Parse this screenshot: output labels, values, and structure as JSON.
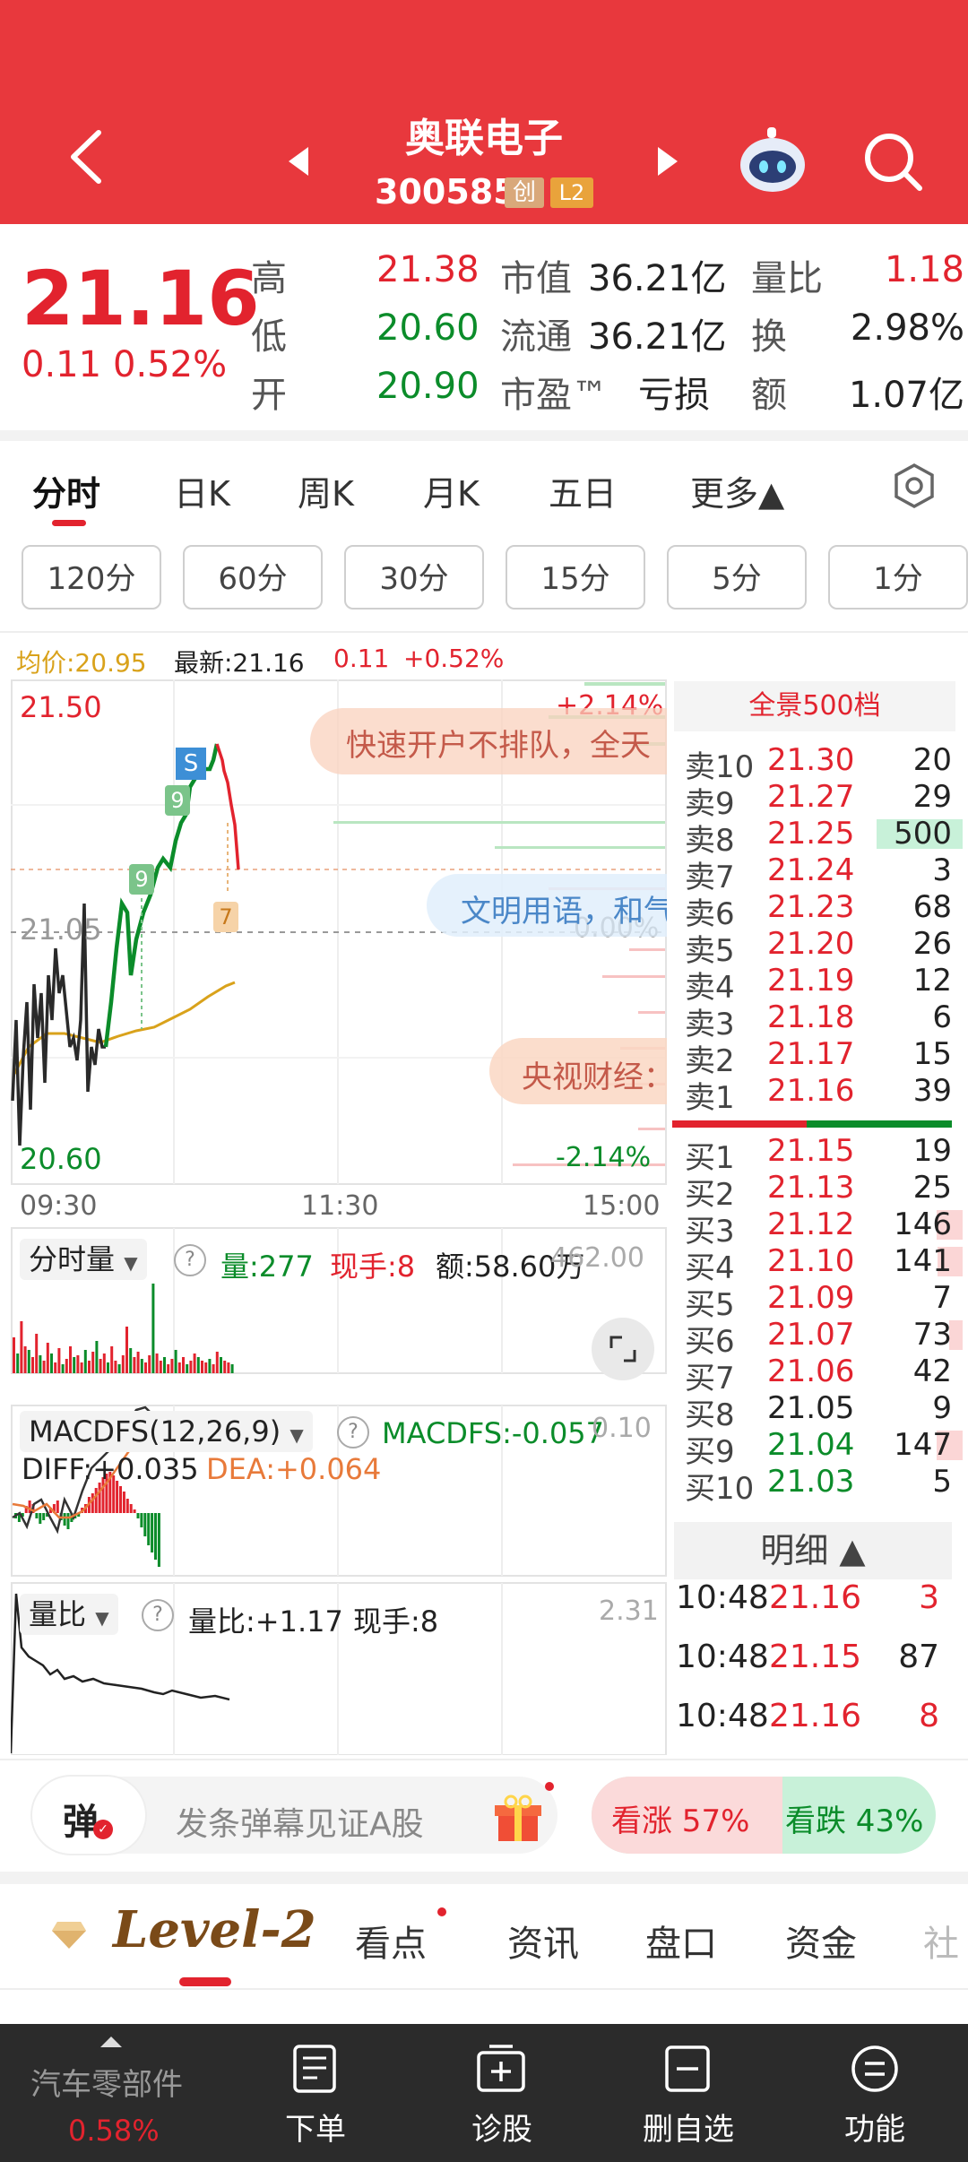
{
  "header": {
    "stock_name": "奥联电子",
    "stock_code": "300585",
    "badge_chuang": "创",
    "badge_l2": "L2",
    "back_icon": "back-arrow-icon",
    "prev_icon": "caret-left-icon",
    "next_icon": "caret-right-icon",
    "robot_icon": "robot-icon",
    "search_icon": "search-icon"
  },
  "quote": {
    "price": "21.16",
    "change": "0.11",
    "change_pct": "0.52%",
    "high_label": "高",
    "high": "21.38",
    "low_label": "低",
    "low": "20.60",
    "open_label": "开",
    "open": "20.90",
    "mcap_label": "市值",
    "mcap": "36.21亿",
    "float_label": "流通",
    "float": "36.21亿",
    "pe_label": "市盈™",
    "pe": "亏损",
    "vr_label": "量比",
    "vr": "1.18",
    "turn_label": "换",
    "turn": "2.98%",
    "amount_label": "额",
    "amount": "1.07亿"
  },
  "chart_tabs": [
    "分时",
    "日K",
    "周K",
    "月K",
    "五日",
    "更多▲"
  ],
  "settings_icon": "hexagon-settings-icon",
  "minute_pills": [
    "120分",
    "60分",
    "30分",
    "15分",
    "5分",
    "1分"
  ],
  "info_bar": {
    "avg": "均价:20.95",
    "latest": "最新:21.16",
    "chg": "0.11",
    "pct": "+0.52%"
  },
  "main_chart": {
    "y_top": "21.50",
    "y_mid": "21.05",
    "y_bot": "20.60",
    "pct_top": "+2.14%",
    "pct_mid": "0.00%",
    "pct_bot": "-2.14%",
    "t_start": "09:30",
    "t_mid": "11:30",
    "t_end": "15:00",
    "marker_s": "S",
    "marker_9a": "9",
    "marker_9b": "9",
    "marker_7": "7",
    "danmu1": "快速开户不排队，全天",
    "danmu2": "文明用语，和气",
    "danmu3": "央视财经："
  },
  "volume_panel": {
    "selector": "分时量",
    "vol": "量:277",
    "hand": "现手:8",
    "amt": "额:58.60万",
    "max": "462.00"
  },
  "macd_panel": {
    "selector": "MACDFS(12,26,9)",
    "macd": "MACDFS:-0.057",
    "max": "0.10",
    "diff": "DIFF:+0.035",
    "dea": "DEA:+0.064"
  },
  "ratio_panel": {
    "selector": "量比",
    "ratio": "量比:+1.17",
    "hand": "现手:8",
    "max": "2.31"
  },
  "orderbook": {
    "title": "全景500档",
    "asks": [
      {
        "label": "卖10",
        "price": "21.30",
        "vol": "20"
      },
      {
        "label": "卖9",
        "price": "21.27",
        "vol": "29"
      },
      {
        "label": "卖8",
        "price": "21.25",
        "vol": "500"
      },
      {
        "label": "卖7",
        "price": "21.24",
        "vol": "3"
      },
      {
        "label": "卖6",
        "price": "21.23",
        "vol": "68"
      },
      {
        "label": "卖5",
        "price": "21.20",
        "vol": "26"
      },
      {
        "label": "卖4",
        "price": "21.19",
        "vol": "12"
      },
      {
        "label": "卖3",
        "price": "21.18",
        "vol": "6"
      },
      {
        "label": "卖2",
        "price": "21.17",
        "vol": "15"
      },
      {
        "label": "卖1",
        "price": "21.16",
        "vol": "39"
      }
    ],
    "bids": [
      {
        "label": "买1",
        "price": "21.15",
        "vol": "19"
      },
      {
        "label": "买2",
        "price": "21.13",
        "vol": "25"
      },
      {
        "label": "买3",
        "price": "21.12",
        "vol": "146"
      },
      {
        "label": "买4",
        "price": "21.10",
        "vol": "141"
      },
      {
        "label": "买5",
        "price": "21.09",
        "vol": "7"
      },
      {
        "label": "买6",
        "price": "21.07",
        "vol": "73"
      },
      {
        "label": "买7",
        "price": "21.06",
        "vol": "42"
      },
      {
        "label": "买8",
        "price": "21.05",
        "vol": "9"
      },
      {
        "label": "买9",
        "price": "21.04",
        "vol": "147"
      },
      {
        "label": "买10",
        "price": "21.03",
        "vol": "5"
      }
    ],
    "detail_title": "明细 ▲",
    "details": [
      {
        "time": "10:48",
        "price": "21.16",
        "vol": "3"
      },
      {
        "time": "10:48",
        "price": "21.15",
        "vol": "87"
      },
      {
        "time": "10:48",
        "price": "21.16",
        "vol": "8"
      }
    ]
  },
  "danmu_bar": {
    "label": "弹",
    "placeholder": "发条弹幕见证A股",
    "rise": "看涨 57%",
    "fall": "看跌 43%",
    "rise_pct": 57,
    "gift_icon": "gift-icon"
  },
  "nav_tabs": {
    "level2": "Level-2",
    "items": [
      "看点",
      "资讯",
      "盘口",
      "资金",
      "社"
    ]
  },
  "bottom_bar": {
    "sector": "汽车零部件",
    "sector_pct": "0.58%",
    "order": "下单",
    "diagnose": "诊股",
    "remove": "删自选",
    "func": "功能"
  },
  "colors": {
    "header_red": "#e8383d",
    "up_red": "#e2232e",
    "down_green": "#0b8c2a",
    "avg_line": "#d9a21b",
    "bottom_bar": "#2b2b2b"
  }
}
